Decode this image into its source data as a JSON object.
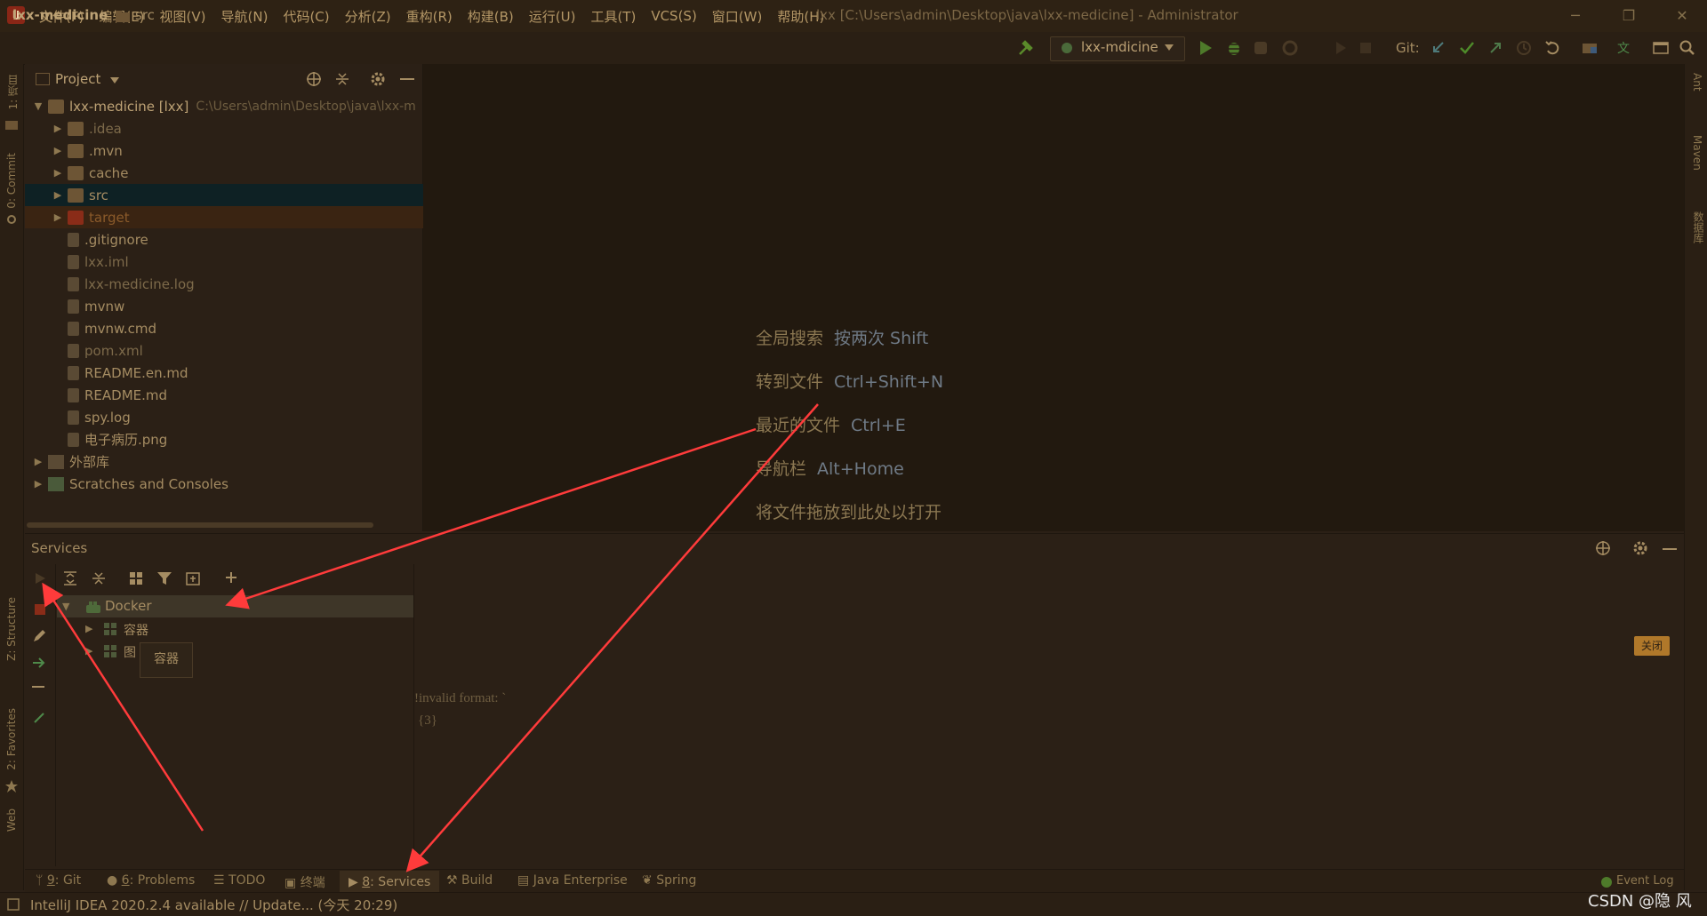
{
  "window": {
    "menus": [
      "文件(F)",
      "编辑(E)",
      "视图(V)",
      "导航(N)",
      "代码(C)",
      "分析(Z)",
      "重构(R)",
      "构建(B)",
      "运行(U)",
      "工具(T)",
      "VCS(S)",
      "窗口(W)",
      "帮助(H)"
    ],
    "title": "lxx [C:\\Users\\admin\\Desktop\\java\\lxx-medicine] - Administrator",
    "minimize": "─",
    "restore": "❐",
    "close": "✕"
  },
  "navbar": {
    "project": "lxx-medicine",
    "folder": "src",
    "run_config": "lxx-mdicine",
    "git_label": "Git:"
  },
  "left_stripe": {
    "project": "1: 项目",
    "commit": "0: Commit",
    "structure": "Z: Structure",
    "favorites": "2: Favorites",
    "web": "Web"
  },
  "right_stripe": {
    "ant": "Ant",
    "maven": "Maven",
    "database": "数据库"
  },
  "project_panel": {
    "title": "Project",
    "root_name": "lxx-medicine [lxx]",
    "root_path": "C:\\Users\\admin\\Desktop\\java\\lxx-m",
    "items": [
      {
        "name": ".idea",
        "kind": "folder",
        "color": "#7d6a4a"
      },
      {
        "name": ".mvn",
        "kind": "folder",
        "color": "#a58c62"
      },
      {
        "name": "cache",
        "kind": "folder",
        "color": "#a58c62"
      },
      {
        "name": "src",
        "kind": "folder",
        "color": "#a58c62"
      },
      {
        "name": "target",
        "kind": "folder-red",
        "color": "#8a5a2a"
      },
      {
        "name": ".gitignore",
        "kind": "file",
        "color": "#a58c62"
      },
      {
        "name": "lxx.iml",
        "kind": "file",
        "color": "#7d6a4a"
      },
      {
        "name": "lxx-medicine.log",
        "kind": "file",
        "color": "#7d6a4a"
      },
      {
        "name": "mvnw",
        "kind": "file",
        "color": "#a58c62"
      },
      {
        "name": "mvnw.cmd",
        "kind": "file",
        "color": "#a58c62"
      },
      {
        "name": "pom.xml",
        "kind": "file",
        "color": "#7d6a4a"
      },
      {
        "name": "README.en.md",
        "kind": "file",
        "color": "#a58c62"
      },
      {
        "name": "README.md",
        "kind": "file",
        "color": "#a58c62"
      },
      {
        "name": "spy.log",
        "kind": "file",
        "color": "#a58c62"
      },
      {
        "name": "电子病历.png",
        "kind": "file",
        "color": "#a58c62"
      }
    ],
    "external_libs": "外部库",
    "scratches": "Scratches and Consoles"
  },
  "editor_hints": [
    {
      "label": "全局搜索",
      "key": "按两次 Shift"
    },
    {
      "label": "转到文件",
      "key": "Ctrl+Shift+N"
    },
    {
      "label": "最近的文件",
      "key": "Ctrl+E"
    },
    {
      "label": "导航栏",
      "key": "Alt+Home"
    },
    {
      "label": "将文件拖放到此处以打开",
      "key": ""
    }
  ],
  "services": {
    "title": "Services",
    "docker": "Docker",
    "containers": "容器",
    "images": "图",
    "tooltip": "容器",
    "close_button": "关闭",
    "error_line1": "!invalid format: `",
    "error_line2": "{3}"
  },
  "bottom_tabs": {
    "git_num": "9",
    "git": ": Git",
    "problems_num": "6",
    "problems": ": Problems",
    "todo": "TODO",
    "terminal": "终端",
    "services_num": "8",
    "services": ": Services",
    "build": "Build",
    "java_enterprise": "Java Enterprise",
    "spring": "Spring",
    "event_log": "Event Log"
  },
  "status": {
    "text": "IntelliJ IDEA 2020.2.4 available // Update... (今天 20:29)",
    "watermark": "CSDN @隐 风"
  },
  "colors": {
    "background": "#2b2016",
    "editor": "#22190f",
    "selection": "#0e2124",
    "accent_green": "#5a8a2a",
    "arrow": "#ff3b3b"
  }
}
